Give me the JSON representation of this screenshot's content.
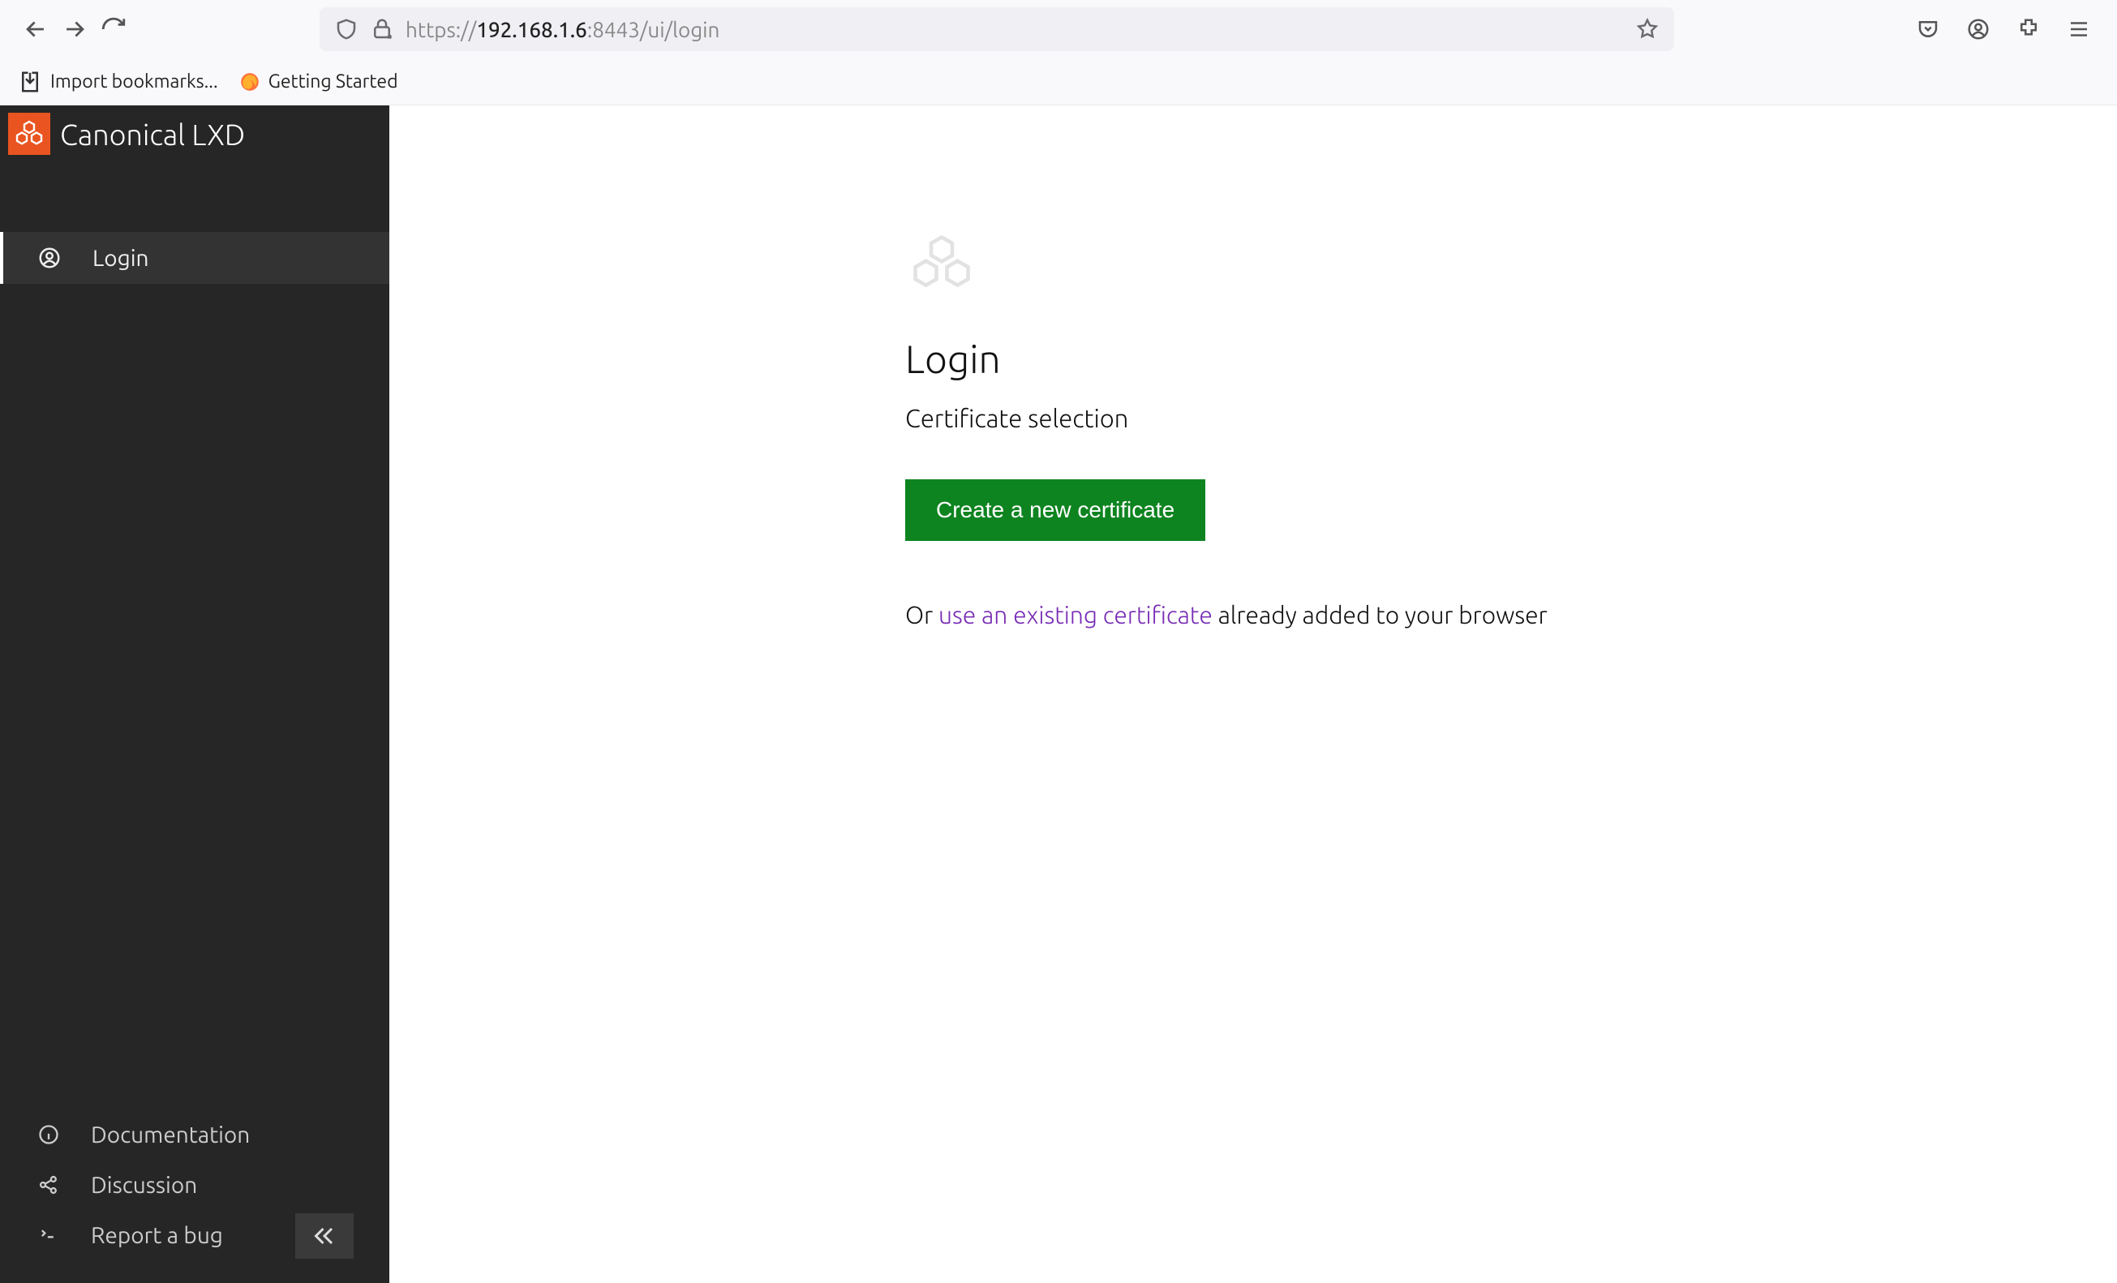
{
  "browser": {
    "url_prefix": "https://",
    "url_host": "192.168.1.6",
    "url_suffix": ":8443/ui/login",
    "bookmarks": [
      {
        "label": "Import bookmarks..."
      },
      {
        "label": "Getting Started"
      }
    ]
  },
  "sidebar": {
    "brand": "Canonical LXD",
    "nav": [
      {
        "label": "Login",
        "active": true
      }
    ],
    "footer": [
      {
        "label": "Documentation"
      },
      {
        "label": "Discussion"
      },
      {
        "label": "Report a bug"
      }
    ]
  },
  "main": {
    "title": "Login",
    "subtitle": "Certificate selection",
    "button": "Create a new certificate",
    "or_prefix": "Or ",
    "link_text": "use an existing certificate",
    "or_suffix": " already added to your browser"
  }
}
